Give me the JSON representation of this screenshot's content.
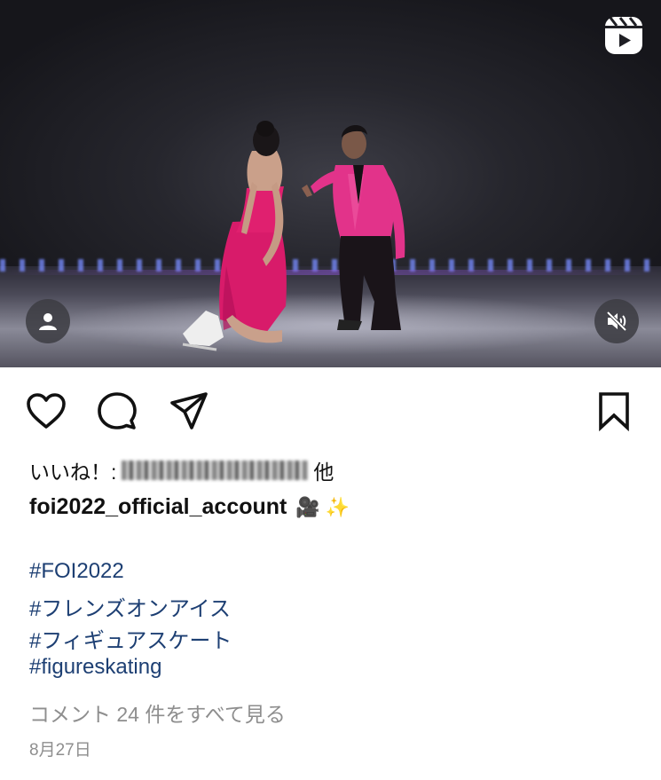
{
  "post": {
    "likes_prefix": "いいね！:",
    "likes_suffix": "他",
    "username": "foi2022_official_account",
    "caption_emojis": "🎥 ✨",
    "hashtags": [
      "#FOI2022",
      "#フレンズオンアイス",
      "#フィギュアスケート",
      "#figureskating"
    ],
    "comments_link": "コメント 24 件をすべて見る",
    "date": "8月27日"
  },
  "icons": {
    "reels": "reels-icon",
    "avatar": "user-icon",
    "mute": "speaker-muted-icon",
    "like": "heart-icon",
    "comment": "comment-bubble-icon",
    "share": "paper-plane-icon",
    "save": "bookmark-icon"
  },
  "colors": {
    "hashtag": "#1d3f73",
    "muted_text": "#8e8e8e",
    "costume": "#e0206f"
  }
}
